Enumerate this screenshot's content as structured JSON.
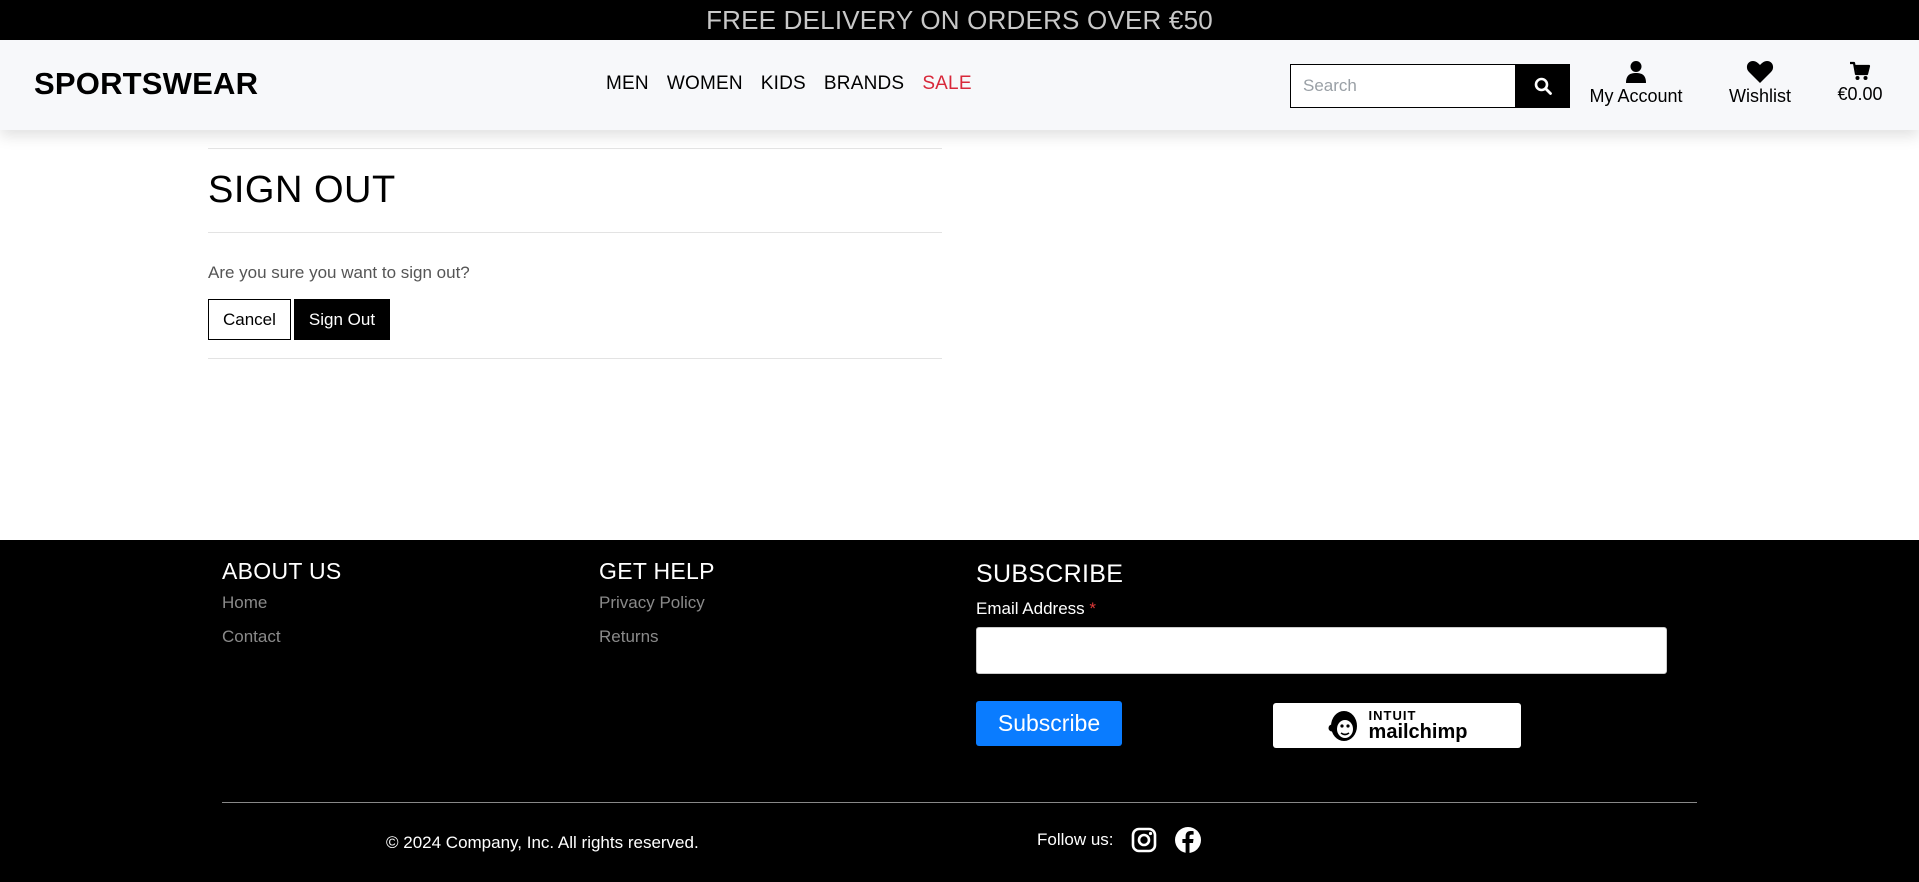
{
  "announcement": "FREE DELIVERY ON ORDERS OVER €50",
  "header": {
    "logo": "SPORTSWEAR",
    "nav": [
      {
        "label": "MEN"
      },
      {
        "label": "WOMEN"
      },
      {
        "label": "KIDS"
      },
      {
        "label": "BRANDS"
      },
      {
        "label": "SALE"
      }
    ],
    "sale_color": "#d8283a",
    "search": {
      "placeholder": "Search",
      "icon": "search-icon"
    },
    "account_label": "My Account",
    "wishlist_label": "Wishlist",
    "cart_total": "€0.00"
  },
  "main": {
    "title": "SIGN OUT",
    "confirm_text": "Are you sure you want to sign out?",
    "cancel_label": "Cancel",
    "signout_label": "Sign Out"
  },
  "footer": {
    "about": {
      "heading": "ABOUT US",
      "links": [
        "Home",
        "Contact"
      ]
    },
    "help": {
      "heading": "GET HELP",
      "links": [
        "Privacy Policy",
        "Returns"
      ]
    },
    "subscribe": {
      "heading": "SUBSCRIBE",
      "email_label": "Email Address",
      "required_mark": "*",
      "button_label": "Subscribe",
      "button_color": "#0a7cff",
      "badge_intuit": "INTUIT",
      "badge_word": "mailchimp"
    },
    "copyright": "© 2024 Company, Inc. All rights reserved.",
    "follow_label": "Follow us:",
    "social_icons": [
      "instagram-icon",
      "facebook-icon"
    ]
  }
}
